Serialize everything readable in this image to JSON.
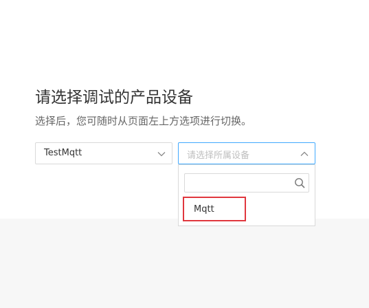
{
  "page": {
    "title": "请选择调试的产品设备",
    "subtitle": "选择后，您可随时从页面左上方选项进行切换。"
  },
  "product_select": {
    "value": "TestMqtt",
    "icon": "chevron-down-icon"
  },
  "device_select": {
    "placeholder": "请选择所属设备",
    "icon": "chevron-up-icon"
  },
  "dropdown": {
    "search_value": "",
    "search_icon": "search-icon",
    "options": [
      {
        "label": "Mqtt",
        "highlighted": true
      }
    ]
  },
  "colors": {
    "highlight_border": "#e0363d",
    "focus_border": "#40a9ff"
  }
}
